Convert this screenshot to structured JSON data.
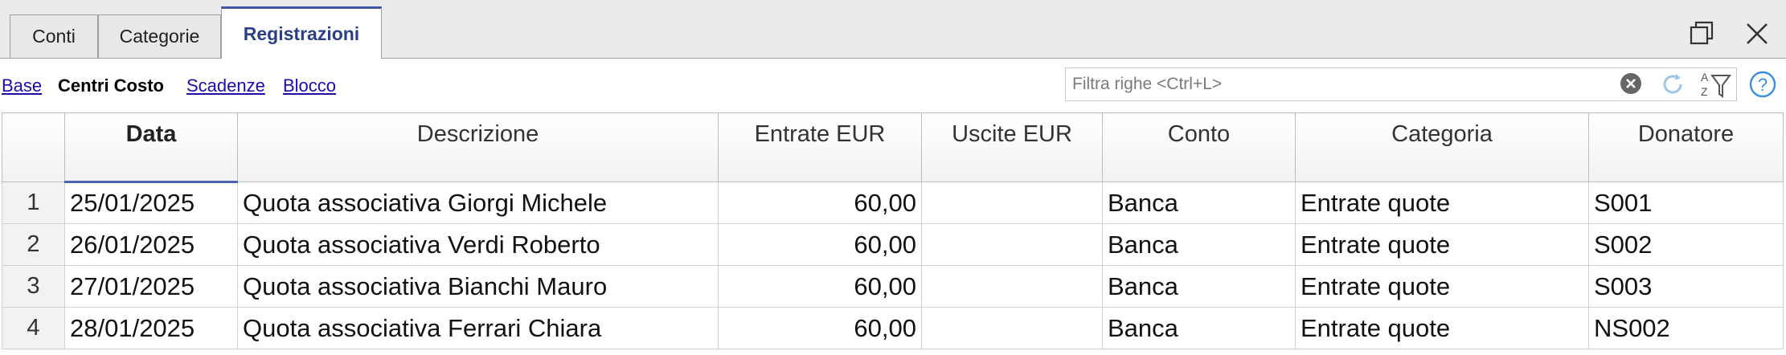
{
  "tabs": [
    {
      "label": "Conti"
    },
    {
      "label": "Categorie"
    },
    {
      "label": "Registrazioni"
    }
  ],
  "views": [
    {
      "label": "Base"
    },
    {
      "label": "Centri Costo"
    },
    {
      "label": "Scadenze"
    },
    {
      "label": "Blocco"
    }
  ],
  "search": {
    "placeholder": "Filtra righe <Ctrl+L>"
  },
  "table": {
    "columns": [
      "Data",
      "Descrizione",
      "Entrate EUR",
      "Uscite EUR",
      "Conto",
      "Categoria",
      "Donatore"
    ],
    "rows": [
      {
        "n": "1",
        "data": "25/01/2025",
        "descrizione": "Quota associativa Giorgi Michele",
        "entrate": "60,00",
        "uscite": "",
        "conto": "Banca",
        "categoria": "Entrate quote",
        "donatore": "S001"
      },
      {
        "n": "2",
        "data": "26/01/2025",
        "descrizione": "Quota associativa Verdi Roberto",
        "entrate": "60,00",
        "uscite": "",
        "conto": "Banca",
        "categoria": "Entrate quote",
        "donatore": "S002"
      },
      {
        "n": "3",
        "data": "27/01/2025",
        "descrizione": "Quota associativa Bianchi Mauro",
        "entrate": "60,00",
        "uscite": "",
        "conto": "Banca",
        "categoria": "Entrate quote",
        "donatore": "S003"
      },
      {
        "n": "4",
        "data": "28/01/2025",
        "descrizione": "Quota associativa Ferrari Chiara",
        "entrate": "60,00",
        "uscite": "",
        "conto": "Banca",
        "categoria": "Entrate quote",
        "donatore": "NS002"
      }
    ]
  },
  "icons": {
    "restore": "restore-window-icon",
    "close": "close-icon",
    "clear": "clear-search-icon",
    "refresh": "refresh-icon",
    "sort_filter": "sort-filter-icon",
    "help": "help-icon"
  },
  "colors": {
    "accent": "#3d55a2",
    "link": "#1a0dab"
  }
}
